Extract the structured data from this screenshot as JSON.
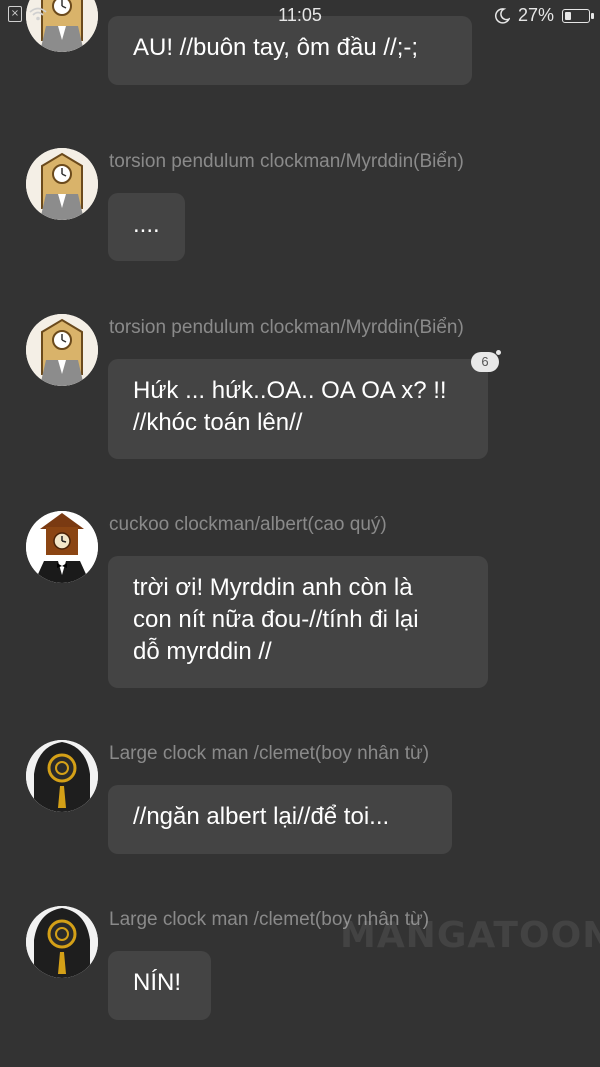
{
  "status_bar": {
    "close_glyph": "×",
    "time": "11:05",
    "battery_text": "27%",
    "battery_level": 0.27
  },
  "messages": [
    {
      "sender": "torsion pendulum clockman/Myrddin(Biển)",
      "lines": [
        "AU! //buôn tay, ôm đầu //;-;"
      ],
      "avatar": "pendulum-clock-icon"
    },
    {
      "sender": "torsion pendulum clockman/Myrddin(Biển)",
      "lines": [
        "...."
      ],
      "avatar": "pendulum-clock-icon"
    },
    {
      "sender": "torsion pendulum clockman/Myrddin(Biển)",
      "lines": [
        "Hứk ... hứk..OA.. OA OA x? !!",
        "//khóc toán lên//"
      ],
      "avatar": "pendulum-clock-icon",
      "badge": "6"
    },
    {
      "sender": "cuckoo clockman/albert(cao quý)",
      "lines": [
        "trời ơi! Myrddin anh còn là",
        "con nít nữa đou-//tính đi lại",
        "dỗ myrddin //"
      ],
      "avatar": "cuckoo-clock-icon"
    },
    {
      "sender": "Large clock man /clemet(boy nhân từ)",
      "lines": [
        "//ngăn albert lại//để toi..."
      ],
      "avatar": "large-clock-icon"
    },
    {
      "sender": "Large clock man /clemet(boy nhân từ)",
      "lines": [
        "NÍN!"
      ],
      "avatar": "large-clock-icon"
    }
  ],
  "watermark": "MANGATOON",
  "colors": {
    "background": "#333333",
    "bubble": "#444444",
    "sender": "#8a8a8a",
    "text": "#ffffff"
  }
}
